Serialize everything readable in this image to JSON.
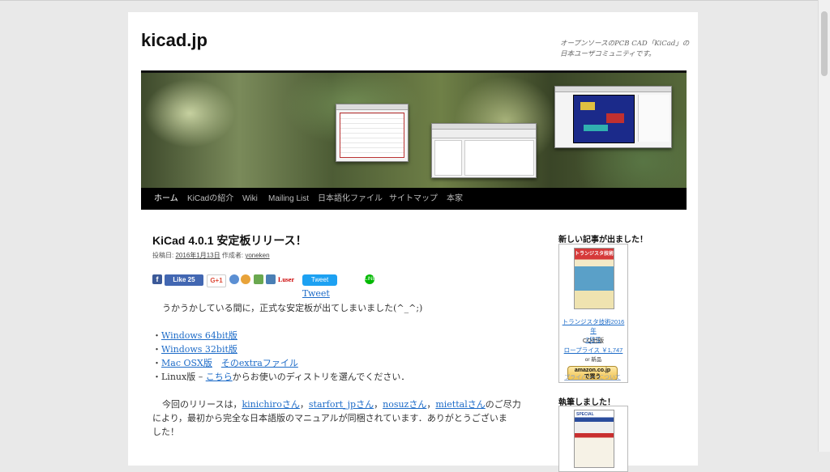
{
  "site": {
    "title": "kicad.jp",
    "tagline": "オープンソースのPCB CAD「KiCad」の日本ユーザコミュニティです。"
  },
  "nav": {
    "items": [
      "ホーム",
      "KiCadの紹介",
      "Wiki",
      "Mailing List",
      "日本語化ファイル",
      "サイトマップ",
      "本家"
    ],
    "active_index": 0
  },
  "post": {
    "title": "KiCad 4.0.1 安定板リリース！",
    "meta": {
      "posted_label": "投稿日:",
      "date": "2016年1月13日",
      "author_label": "作成者:",
      "author": "yoneken"
    },
    "share": {
      "facebook_icon": "f",
      "like_label": "Like 25",
      "gplus_label": "G+1",
      "luser_label": "Luser",
      "tweet_button": "Tweet",
      "line_icon": "LINE",
      "tweet_link": "Tweet"
    },
    "intro": "うかうかしている間に，正式な安定板が出てしまいました(^_^;)",
    "downloads": [
      {
        "bullet": "・",
        "link": "Windows 64bit版",
        "extra_sep": "",
        "extra_link": "",
        "after": ""
      },
      {
        "bullet": "・",
        "link": "Windows 32bit版",
        "extra_sep": "",
        "extra_link": "",
        "after": ""
      },
      {
        "bullet": "・",
        "link": "Mac OSX版",
        "extra_sep": "　",
        "extra_link": "そのextraファイル",
        "after": ""
      },
      {
        "bullet": "・",
        "link": "",
        "extra_sep": "",
        "extra_link": "",
        "after": ""
      }
    ],
    "linux": {
      "prefix": "・Linux版 – ",
      "link": "こちら",
      "suffix": "からお使いのディストリを選んでください．"
    },
    "thanks": {
      "prefix": "今回のリリースは，",
      "contributors": [
        "kinichiroさん",
        "starfort_jpさん",
        "nosuzさん",
        "miettalさん"
      ],
      "sep": "，",
      "line1_suffix": "のご尽力",
      "line2": "により，最初から完全な日本語版のマニュアルが同梱されています．ありがとうございま",
      "line3": "した！"
    }
  },
  "sidebar": {
    "widget1": {
      "title": "新しい記事が出ました！",
      "cover_text": "トランジスタ技術",
      "book_title_line1": "トランジスタ技術2016年",
      "book_title_line2": "7月号",
      "publisher": "CQ出版",
      "price": "ロープライス ￥1,747",
      "condition": "or 新品",
      "amazon_line1": "amazon.co.jp",
      "amazon_line2": "で買う",
      "privacy": "プライバシーについて"
    },
    "widget2": {
      "title": "執筆しました！",
      "cover_text": "SPECIAL"
    }
  },
  "colors": {
    "link": "#1e6cc8",
    "nav_bg": "#000000",
    "facebook": "#3b5998",
    "twitter": "#1da1f2",
    "line": "#00b900"
  }
}
